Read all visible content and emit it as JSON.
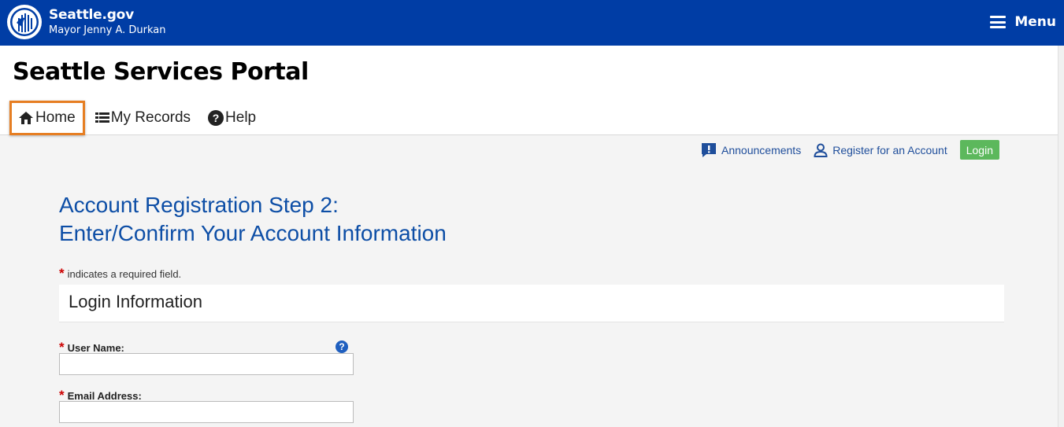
{
  "topbar": {
    "brand_title": "Seattle.gov",
    "brand_subtitle": "Mayor Jenny A. Durkan",
    "menu_label": "Menu"
  },
  "header": {
    "portal_title": "Seattle Services Portal",
    "nav": [
      {
        "label": "Home",
        "icon": "home-icon"
      },
      {
        "label": "My Records",
        "icon": "list-icon"
      },
      {
        "label": "Help",
        "icon": "question-circle-icon"
      }
    ]
  },
  "utility": {
    "announcements": "Announcements",
    "register": "Register for an Account",
    "login": "Login"
  },
  "page": {
    "heading_line1": "Account Registration Step 2:",
    "heading_line2": "Enter/Confirm Your Account Information",
    "required_note": "indicates a required field.",
    "required_marker": "*",
    "section_title": "Login Information"
  },
  "fields": {
    "username_label": "User Name:",
    "username_value": "",
    "email_label": "Email Address:",
    "email_value": "",
    "help_glyph": "?"
  },
  "colors": {
    "topbar": "#003da5",
    "heading": "#0d4ea6",
    "login_button": "#5cb85c",
    "active_nav_outline": "#e67e22",
    "required_star": "#cc0000"
  }
}
